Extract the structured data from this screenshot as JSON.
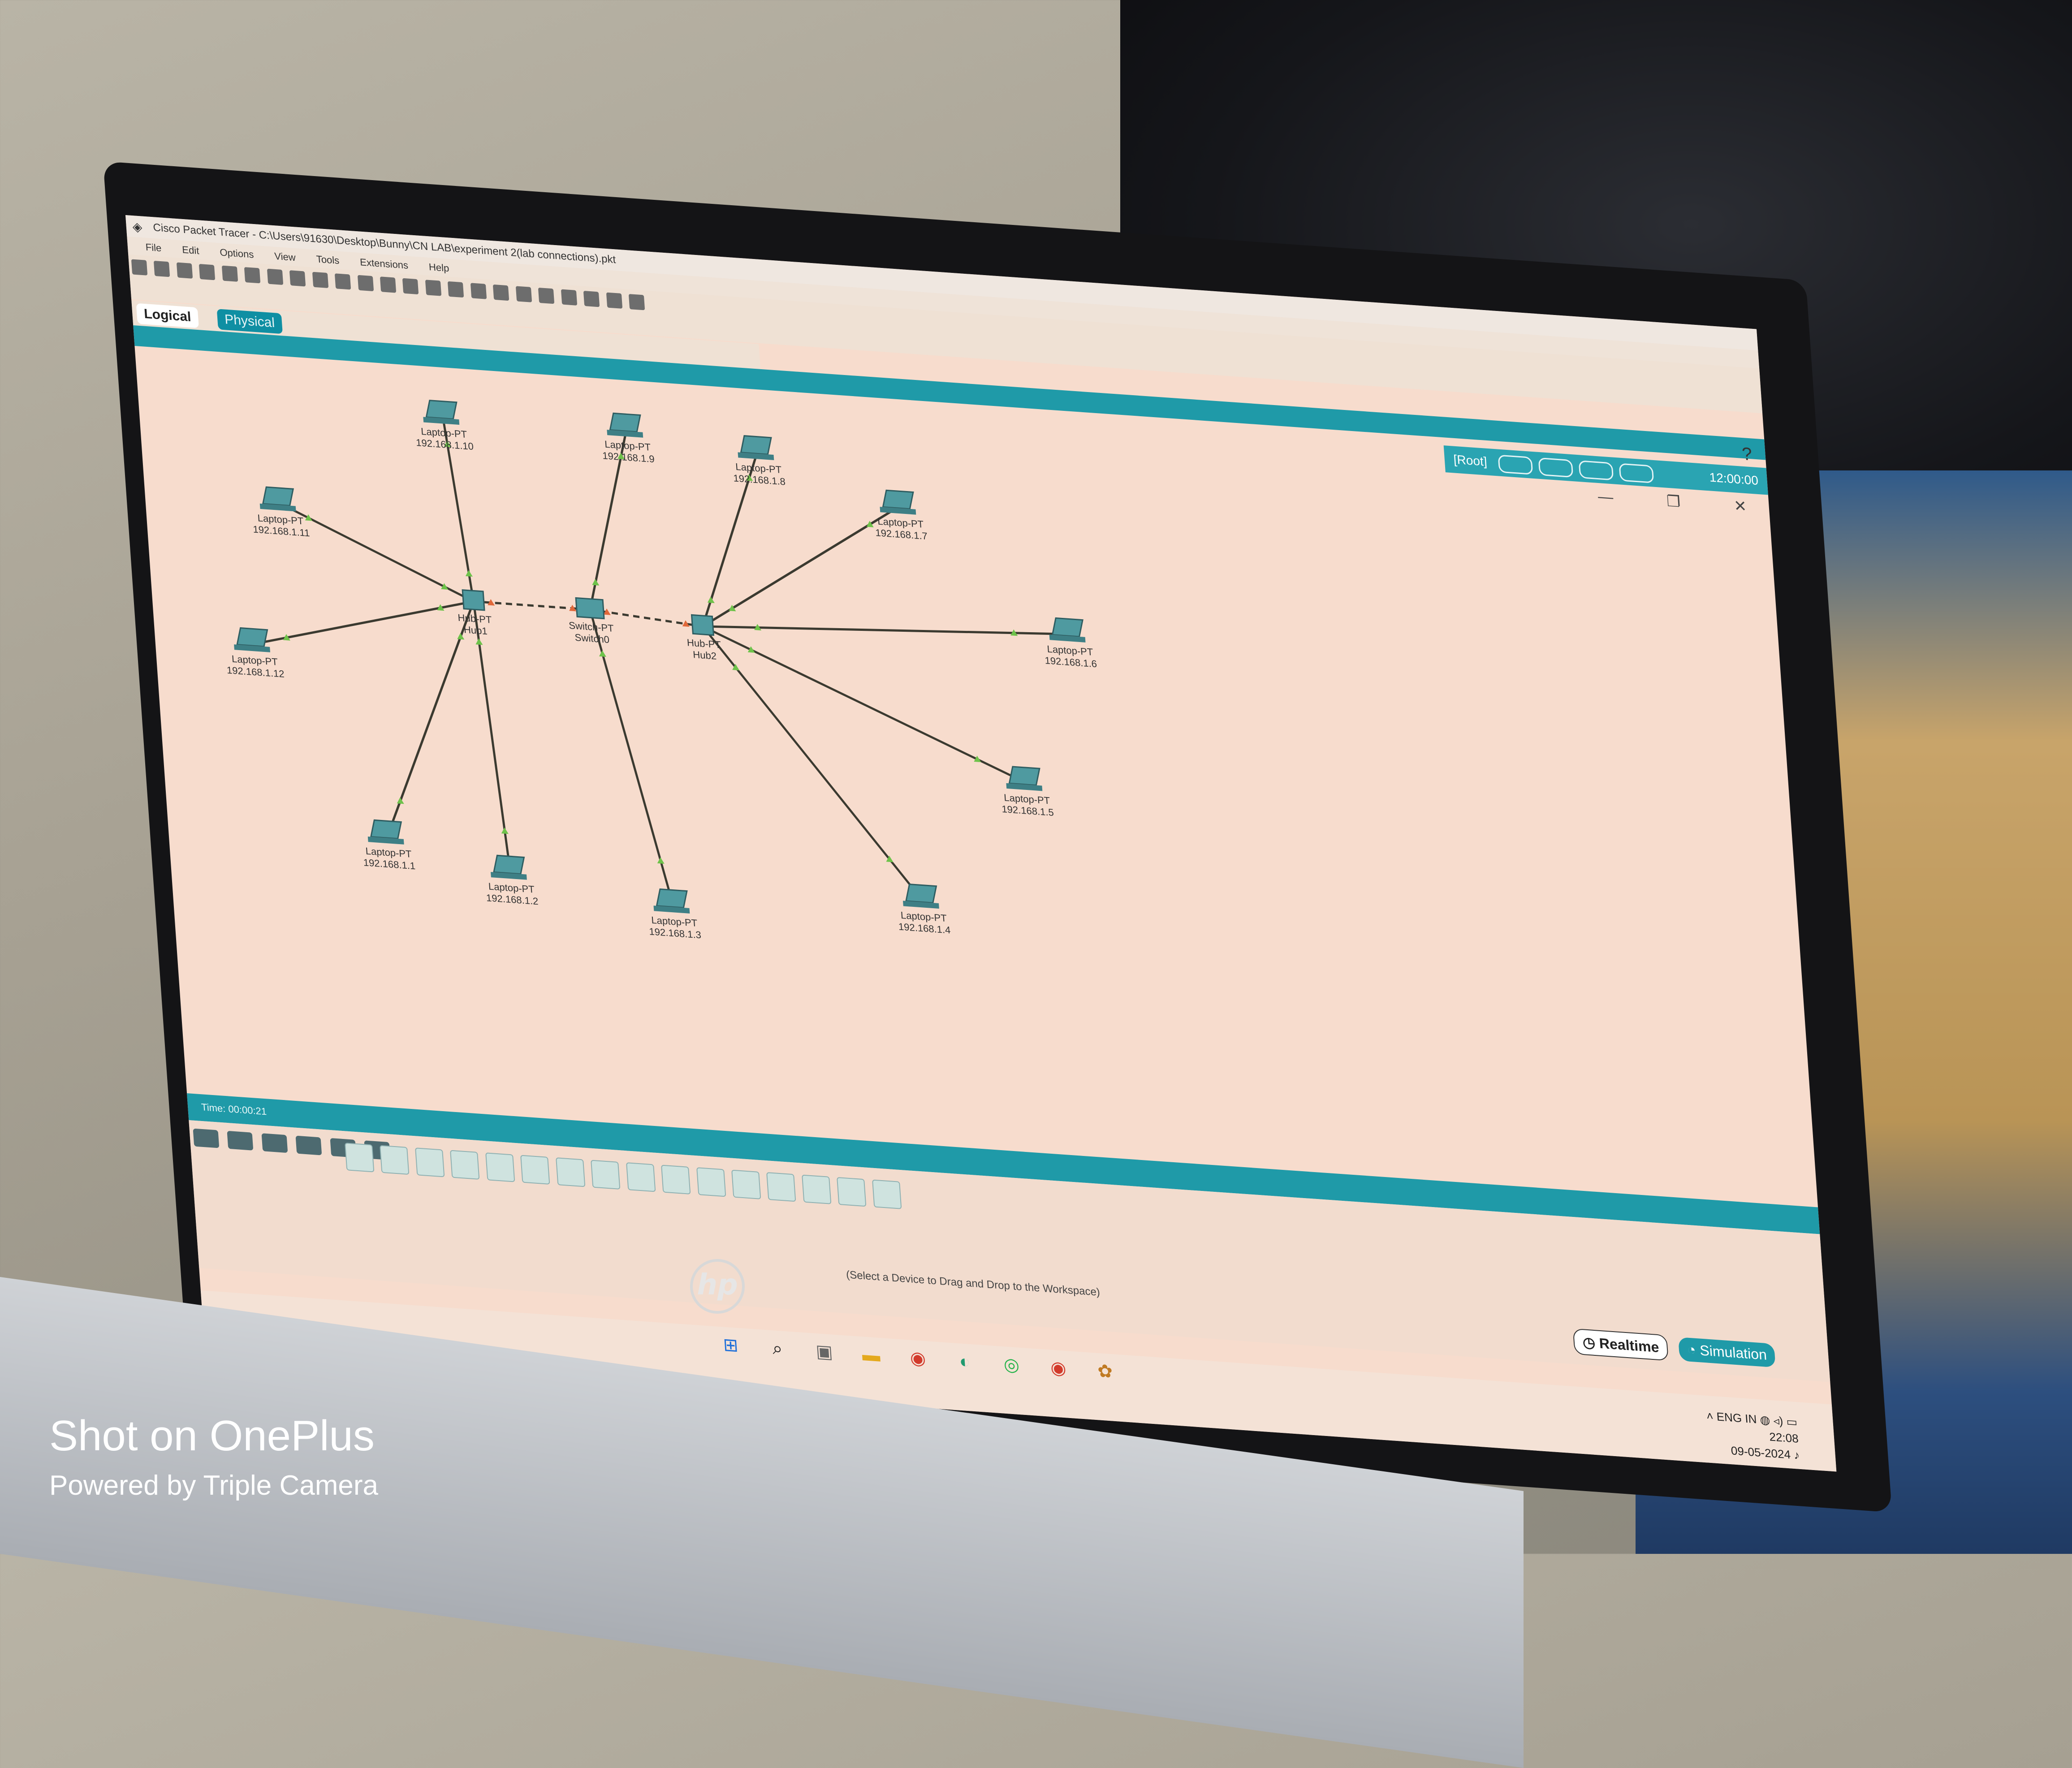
{
  "window": {
    "title": "Cisco Packet Tracer - C:\\Users\\91630\\Desktop\\Bunny\\CN LAB\\experiment 2(lab connections).pkt",
    "controls": [
      "—",
      "❐",
      "✕"
    ],
    "help": "?"
  },
  "menu": [
    "File",
    "Edit",
    "Options",
    "View",
    "Tools",
    "Extensions",
    "Help"
  ],
  "tabs": {
    "logical": "Logical",
    "physical": "Physical"
  },
  "root_bar": {
    "root": "[Root]",
    "clock": "12:00:00"
  },
  "network": {
    "devices": [
      {
        "id": "hub1",
        "type": "Hub-PT",
        "name": "Hub1"
      },
      {
        "id": "switch0",
        "type": "Switch-PT",
        "name": "Switch0"
      },
      {
        "id": "hub2",
        "type": "Hub-PT",
        "name": "Hub2"
      },
      {
        "id": "l10",
        "type": "Laptop-PT",
        "ip": "192.168.1.10"
      },
      {
        "id": "l9",
        "type": "Laptop-PT",
        "ip": "192.168.1.9"
      },
      {
        "id": "l8",
        "type": "Laptop-PT",
        "ip": "192.168.1.8"
      },
      {
        "id": "l7",
        "type": "Laptop-PT",
        "ip": "192.168.1.7"
      },
      {
        "id": "l6",
        "type": "Laptop-PT",
        "ip": "192.168.1.6"
      },
      {
        "id": "l5",
        "type": "Laptop-PT",
        "ip": "192.168.1.5"
      },
      {
        "id": "l4",
        "type": "Laptop-PT",
        "ip": "192.168.1.4"
      },
      {
        "id": "l3",
        "type": "Laptop-PT",
        "ip": "192.168.1.3"
      },
      {
        "id": "l2",
        "type": "Laptop-PT",
        "ip": "192.168.1.2"
      },
      {
        "id": "l1",
        "type": "Laptop-PT",
        "ip": "192.168.1.1"
      },
      {
        "id": "l11",
        "type": "Laptop-PT",
        "ip": "192.168.1.11"
      },
      {
        "id": "l12",
        "type": "Laptop-PT",
        "ip": "192.168.1.12"
      }
    ]
  },
  "bottom": {
    "time": "Time: 00:00:21",
    "status_message": "(Select a Device to Drag and Drop to the Workspace)",
    "realtime": "Realtime",
    "simulation": "Simulation"
  },
  "taskbar": {
    "lang_line1": "ENG",
    "lang_line2": "IN",
    "time": "22:08",
    "date": "09-05-2024"
  },
  "branding": {
    "laptop_logo": "hp"
  },
  "watermark": {
    "line1": "Shot on OnePlus",
    "line2": "Powered by Triple Camera"
  }
}
